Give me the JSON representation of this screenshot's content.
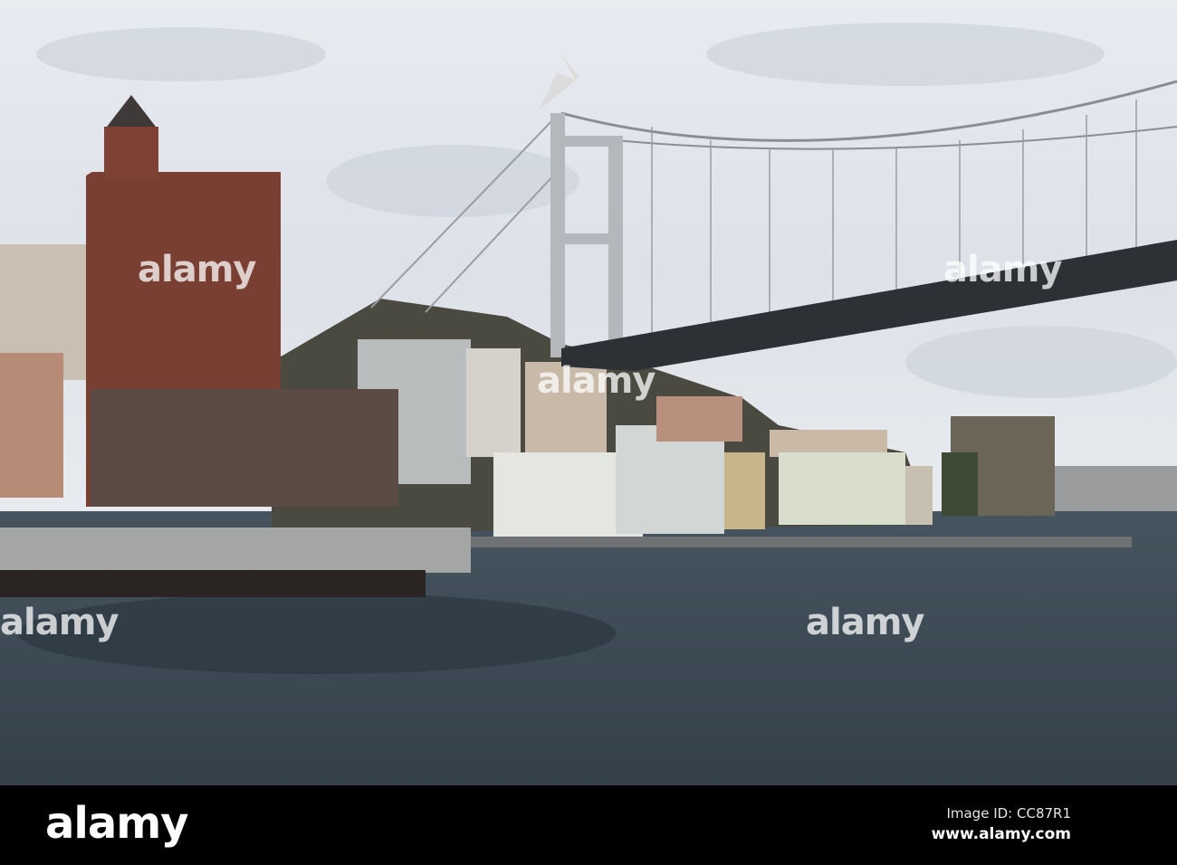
{
  "watermark": {
    "text": "alamy"
  },
  "footer": {
    "logo": "alamy",
    "image_id": "Image ID: CC87R1",
    "url": "www.alamy.com"
  },
  "colors": {
    "sky": "#dfe3e9",
    "water": "#3b4954",
    "tower_brick": "#7a3f33",
    "bridge_deck": "#2d3136"
  }
}
